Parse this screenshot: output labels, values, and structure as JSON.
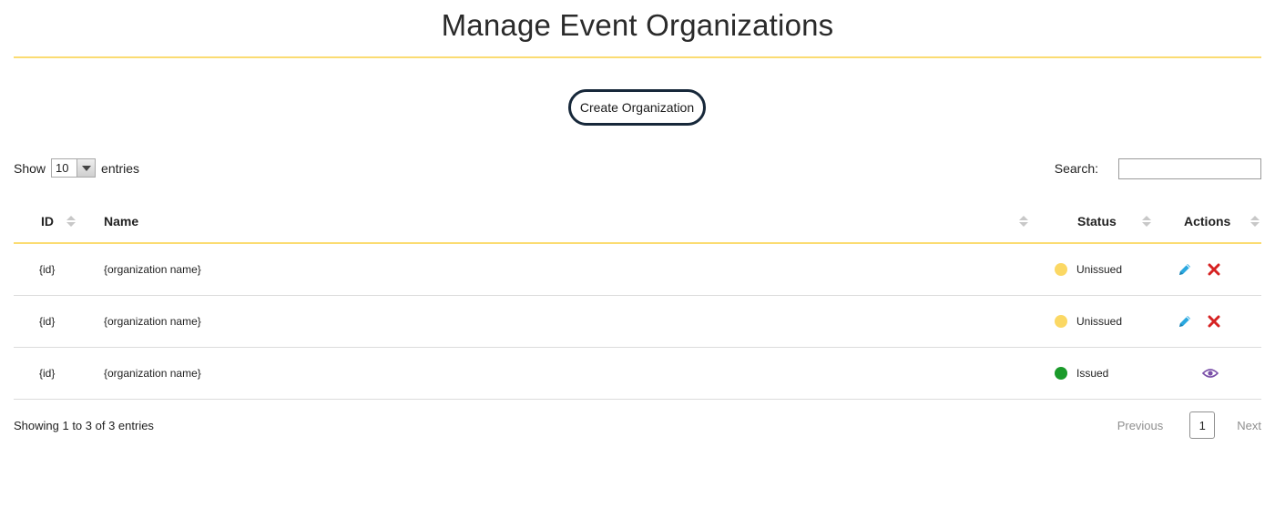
{
  "header": {
    "title": "Manage Event Organizations"
  },
  "toolbar": {
    "create_label": "Create Organization"
  },
  "length": {
    "show_label": "Show",
    "value": "10",
    "entries_label": "entries"
  },
  "search": {
    "label": "Search:",
    "value": ""
  },
  "table": {
    "columns": [
      "ID",
      "Name",
      "Status",
      "Actions"
    ],
    "rows": [
      {
        "id": "{id}",
        "name": "{organization name}",
        "status": "Unissued",
        "status_color": "#fbd864",
        "actions": [
          "pencil-icon",
          "close-icon"
        ]
      },
      {
        "id": "{id}",
        "name": "{organization name}",
        "status": "Unissued",
        "status_color": "#fbd864",
        "actions": [
          "pencil-icon",
          "close-icon"
        ]
      },
      {
        "id": "{id}",
        "name": "{organization name}",
        "status": "Issued",
        "status_color": "#1a9a2a",
        "actions": [
          "eye-icon"
        ]
      }
    ]
  },
  "footer": {
    "info": "Showing 1 to 3 of 3 entries",
    "previous_label": "Previous",
    "current_page": "1",
    "next_label": "Next"
  },
  "colors": {
    "accent": "#fbdc72",
    "edit": "#2aa8e0",
    "delete": "#d62222",
    "view": "#7a4fa8",
    "button_border": "#17283a"
  }
}
